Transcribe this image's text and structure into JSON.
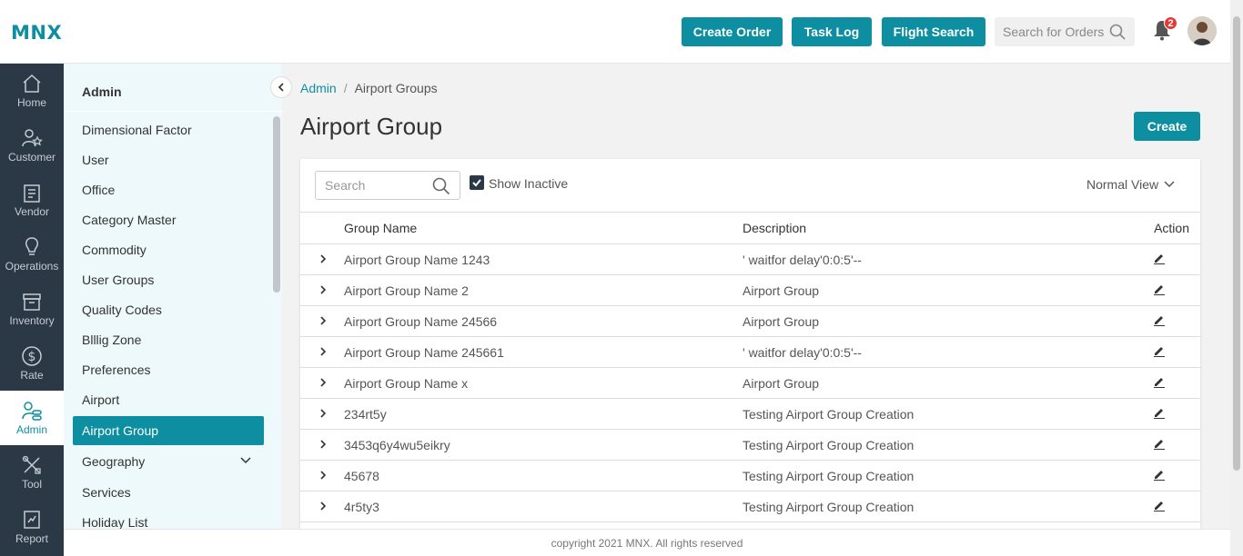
{
  "header": {
    "logo": "MNX",
    "buttons": [
      "Create Order",
      "Task Log",
      "Flight Search"
    ],
    "search_placeholder": "Search for Orders",
    "notification_count": "2"
  },
  "rail": [
    {
      "label": "Home",
      "icon": "home-icon"
    },
    {
      "label": "Customer",
      "icon": "customer-icon"
    },
    {
      "label": "Vendor",
      "icon": "vendor-icon"
    },
    {
      "label": "Operations",
      "icon": "lightbulb-icon"
    },
    {
      "label": "Inventory",
      "icon": "inventory-icon"
    },
    {
      "label": "Rate",
      "icon": "dollar-icon"
    },
    {
      "label": "Admin",
      "icon": "admin-icon"
    },
    {
      "label": "Tool",
      "icon": "tool-icon"
    },
    {
      "label": "Report",
      "icon": "report-icon"
    }
  ],
  "submenu": {
    "title": "Admin",
    "items": [
      "Dimensional Factor",
      "User",
      "Office",
      "Category Master",
      "Commodity",
      "User Groups",
      "Quality Codes",
      "Blllig Zone",
      "Preferences",
      "Airport",
      "Airport Group",
      "Geography",
      "Services",
      "Holiday List"
    ],
    "active": "Airport Group"
  },
  "breadcrumb": {
    "root": "Admin",
    "current": "Airport Groups"
  },
  "page": {
    "title": "Airport Group",
    "create_label": "Create"
  },
  "toolbar": {
    "search_placeholder": "Search",
    "show_inactive": "Show Inactive",
    "view": "Normal View"
  },
  "table": {
    "columns": [
      "Group Name",
      "Description",
      "Action"
    ],
    "rows": [
      {
        "name": "Airport Group Name 1243",
        "description": "' waitfor delay'0:0:5'--"
      },
      {
        "name": "Airport Group Name 2",
        "description": "Airport Group"
      },
      {
        "name": "Airport Group Name 24566",
        "description": "Airport Group"
      },
      {
        "name": "Airport Group Name 245661",
        "description": "' waitfor delay'0:0:5'--"
      },
      {
        "name": "Airport Group Name x",
        "description": "Airport Group"
      },
      {
        "name": "234rt5y",
        "description": "Testing Airport Group Creation"
      },
      {
        "name": "3453q6y4wu5eikry",
        "description": "Testing Airport Group Creation"
      },
      {
        "name": "45678",
        "description": "Testing Airport Group Creation"
      },
      {
        "name": "4r5ty3",
        "description": "Testing Airport Group Creation"
      }
    ]
  },
  "footer": "copyright 2021 MNX. All rights reserved",
  "colors": {
    "accent": "#0e8fa1",
    "rail": "#2b3947",
    "submenu_bg": "#eef9fb",
    "badge": "#e53935"
  }
}
